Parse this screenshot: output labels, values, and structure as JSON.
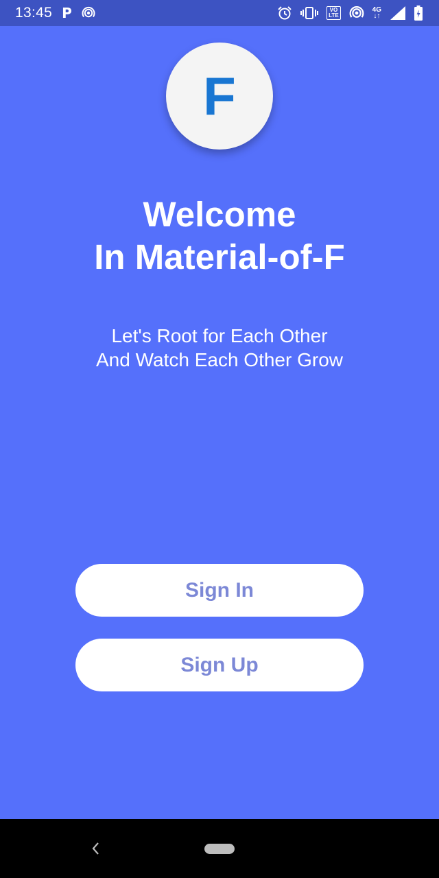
{
  "status_bar": {
    "time": "13:45",
    "left_icons": [
      "parking-p-icon",
      "hotspot-icon"
    ],
    "right_icons": [
      "alarm-icon",
      "vibrate-icon",
      "volte-icon",
      "hotspot-icon",
      "4g-icon",
      "signal-icon",
      "battery-icon"
    ],
    "volte_line1": "VO",
    "volte_line2": "LTE",
    "network_type": "4G"
  },
  "logo": {
    "letter": "F",
    "letter_color": "#1976D2"
  },
  "welcome": {
    "line1": "Welcome",
    "line2": "In Material-of-F"
  },
  "tagline": {
    "line1": "Let's Root for Each Other",
    "line2": "And Watch Each Other Grow"
  },
  "buttons": {
    "sign_in": "Sign In",
    "sign_up": "Sign Up"
  },
  "colors": {
    "background": "#5570FB",
    "status_bar": "#3D53C2",
    "button_text": "#7C88D6"
  },
  "nav_bar": {
    "icons": [
      "back-chevron-icon",
      "home-pill-icon"
    ]
  }
}
